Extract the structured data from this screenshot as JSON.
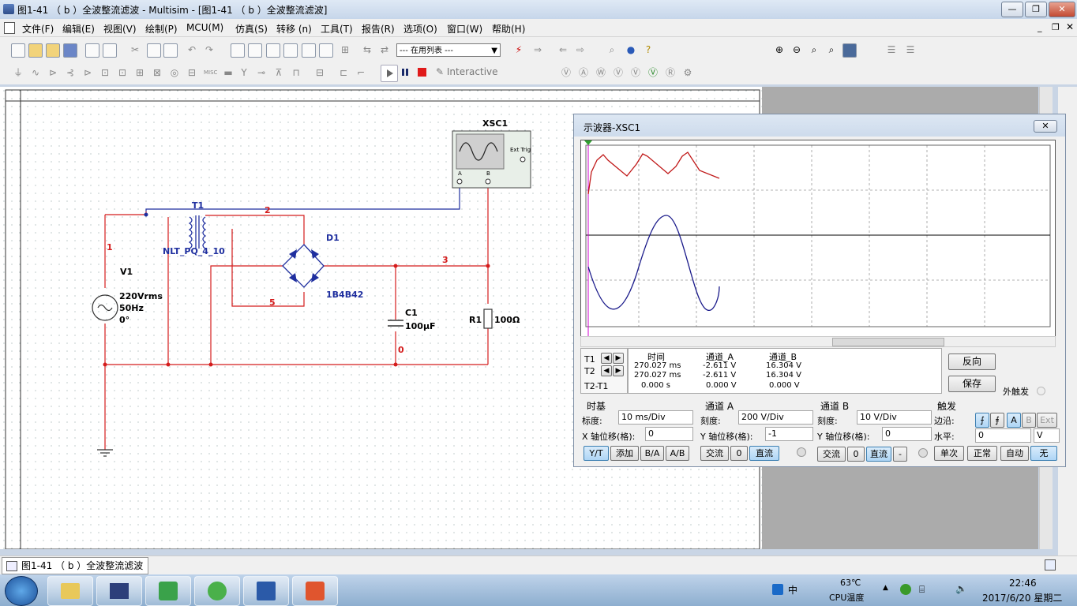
{
  "window": {
    "title": "图1-41 （ b ）全波整流滤波 - Multisim - [图1-41 （ b ）全波整流滤波]"
  },
  "menus": [
    "文件(F)",
    "编辑(E)",
    "视图(V)",
    "绘制(P)",
    "MCU(M)",
    "仿真(S)",
    "转移 (n)",
    "工具(T)",
    "报告(R)",
    "选项(O)",
    "窗口(W)",
    "帮助(H)"
  ],
  "toolbar": {
    "in_use_list": "--- 在用列表 ---",
    "interactive": "Interactive"
  },
  "schematic": {
    "xsc_label": "XSC1",
    "ext_trig": "Ext Trig",
    "t1_label": "T1",
    "t1_model": "NLT_PQ_4_10",
    "d1_label": "D1",
    "d1_model": "1B4B42",
    "v1_label": "V1",
    "v1_specs": [
      "220Vrms",
      "50Hz",
      "0°"
    ],
    "c1_label": "C1",
    "c1_value": "100µF",
    "r1_label": "R1",
    "r1_value": "100Ω",
    "nets": [
      "1",
      "2",
      "3",
      "5",
      "0"
    ],
    "scope_pin_a": "A",
    "scope_pin_b": "B"
  },
  "scope": {
    "title": "示波器-XSC1",
    "readout": {
      "headers": [
        "时间",
        "通道_A",
        "通道_B"
      ],
      "rows": [
        {
          "label": "T1",
          "time": "270.027 ms",
          "a": "-2.611 V",
          "b": "16.304 V"
        },
        {
          "label": "T2",
          "time": "270.027 ms",
          "a": "-2.611 V",
          "b": "16.304 V"
        },
        {
          "label": "T2-T1",
          "time": "0.000 s",
          "a": "0.000 V",
          "b": "0.000 V"
        }
      ]
    },
    "buttons": {
      "reverse": "反向",
      "save": "保存",
      "ext_trigger": "外触发"
    },
    "timebase": {
      "title": "时基",
      "scale_label": "标度:",
      "scale": "10 ms/Div",
      "xpos_label": "X 轴位移(格):",
      "xpos": "0",
      "modes": [
        "Y/T",
        "添加",
        "B/A",
        "A/B"
      ]
    },
    "chan_a": {
      "title": "通道 A",
      "scale_label": "刻度:",
      "scale": "200  V/Div",
      "ypos_label": "Y 轴位移(格):",
      "ypos": "-1",
      "coupling": [
        "交流",
        "0",
        "直流"
      ]
    },
    "chan_b": {
      "title": "通道 B",
      "scale_label": "刻度:",
      "scale": "10  V/Div",
      "ypos_label": "Y 轴位移(格):",
      "ypos": "0",
      "coupling": [
        "交流",
        "0",
        "直流",
        "-"
      ]
    },
    "trigger": {
      "title": "触发",
      "edge_label": "边沿:",
      "level_label": "水平:",
      "level": "0",
      "unit": "V",
      "edges": [
        "A",
        "B",
        "Ext"
      ],
      "modes": [
        "单次",
        "正常",
        "自动",
        "无"
      ]
    }
  },
  "doc_tab": "图1-41 （ b ）全波整流滤波",
  "tray": {
    "temp": "63℃",
    "temp_label": "CPU温度",
    "time": "22:46",
    "date": "2017/6/20 星期二",
    "ime": "中"
  }
}
